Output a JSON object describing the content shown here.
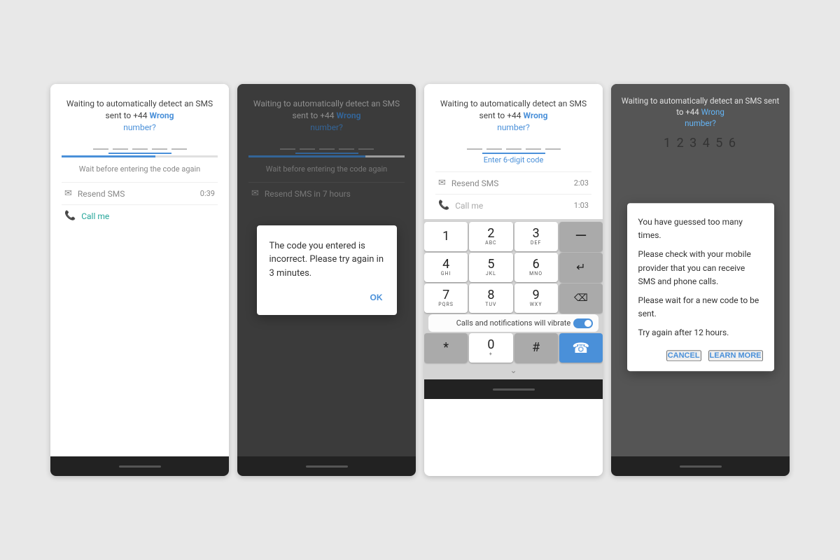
{
  "screens": [
    {
      "id": "screen1",
      "type": "normal",
      "sms_text": "Waiting to automatically detect an SMS sent to +44",
      "wrong_label": "Wrong",
      "number_label": "number?",
      "code_dashes": [
        "—",
        "—",
        "—",
        "—",
        "—"
      ],
      "progress_width": "60%",
      "wait_text": "Wait before entering the code again",
      "resend_label": "Resend SMS",
      "resend_timer": "0:39",
      "call_label": "Call me",
      "has_modal": false
    },
    {
      "id": "screen2",
      "type": "with_modal",
      "sms_text": "Waiting to automatically detect an SMS sent to +44",
      "wrong_label": "Wrong",
      "number_label": "number?",
      "code_dashes": [
        "—",
        "—",
        "—",
        "—",
        "—"
      ],
      "progress_width": "75%",
      "wait_text": "Wait before entering the code again",
      "resend_label": "Resend SMS in 7 hours",
      "modal_text": "The code you entered is incorrect. Please try again in 3 minutes.",
      "modal_ok": "OK",
      "has_modal": true
    },
    {
      "id": "screen3",
      "type": "with_keyboard",
      "sms_text": "Waiting to automatically detect an SMS sent to +44",
      "wrong_label": "Wrong",
      "number_label": "number?",
      "code_dashes": [
        "—",
        "—",
        "—",
        "—",
        "—"
      ],
      "progress_width": "80%",
      "enter_code_hint": "Enter 6-digit code",
      "resend_label": "Resend SMS",
      "resend_timer": "2:03",
      "call_label": "Call me",
      "call_timer": "1:03",
      "keyboard": {
        "rows": [
          [
            {
              "main": "1",
              "sub": ""
            },
            {
              "main": "2",
              "sub": "ABC"
            },
            {
              "main": "3",
              "sub": "DEF"
            },
            {
              "main": "—",
              "sub": "",
              "dark": true
            }
          ],
          [
            {
              "main": "4",
              "sub": "GHI"
            },
            {
              "main": "5",
              "sub": "JKL"
            },
            {
              "main": "6",
              "sub": "MNO"
            },
            {
              "main": "↵",
              "sub": "",
              "dark": true
            }
          ],
          [
            {
              "main": "7",
              "sub": "PQRS"
            },
            {
              "main": "8",
              "sub": "TUV"
            },
            {
              "main": "9",
              "sub": "WXY"
            },
            {
              "main": "⌫",
              "sub": "",
              "dark": true
            }
          ]
        ],
        "bottom_row": [
          {
            "main": "*",
            "sub": "",
            "dark": true
          },
          {
            "main": "0",
            "sub": "+"
          },
          {
            "main": "#",
            "sub": "",
            "dark": true
          }
        ]
      },
      "vibrate_text": "Calls and notifications will vibrate",
      "has_modal": false
    },
    {
      "id": "screen4",
      "type": "with_big_modal",
      "sms_text": "Waiting to automatically detect an SMS sent to +44",
      "wrong_label": "Wrong",
      "number_label": "number?",
      "code_digits": "1 2 3 4 5 6",
      "modal": {
        "line1": "You have guessed too many times.",
        "line2": "Please check with your mobile provider that you can receive SMS and phone calls.",
        "line3": "Please wait for a new code to be sent.",
        "line4": "Try again after 12 hours.",
        "cancel_label": "CANCEL",
        "learn_more_label": "LEARN MORE"
      },
      "has_modal": true
    }
  ]
}
